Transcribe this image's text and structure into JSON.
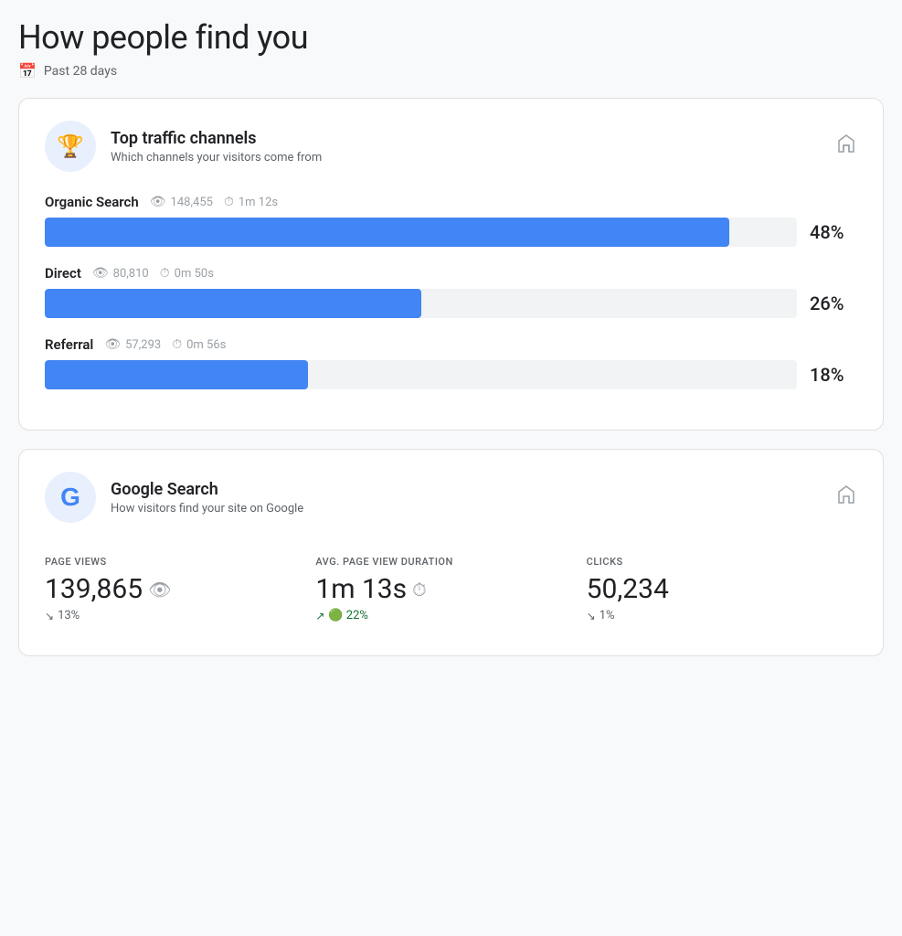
{
  "page": {
    "title": "How people find you",
    "date_range": "Past 28 days"
  },
  "traffic_card": {
    "title": "Top traffic channels",
    "subtitle": "Which channels your visitors come from",
    "channels": [
      {
        "name": "Organic Search",
        "views": "148,455",
        "duration": "1m 12s",
        "percent": 48,
        "percent_label": "48%",
        "bar_width": "91"
      },
      {
        "name": "Direct",
        "views": "80,810",
        "duration": "0m 50s",
        "percent": 26,
        "percent_label": "26%",
        "bar_width": "50"
      },
      {
        "name": "Referral",
        "views": "57,293",
        "duration": "0m 56s",
        "percent": 18,
        "percent_label": "18%",
        "bar_width": "35"
      }
    ]
  },
  "google_search_card": {
    "title": "Google Search",
    "subtitle": "How visitors find your site on Google",
    "stats": [
      {
        "label": "PAGE VIEWS",
        "value": "139,865",
        "has_eye_icon": true,
        "change": "13%",
        "change_direction": "down"
      },
      {
        "label": "AVG. PAGE VIEW DURATION",
        "value": "1m 13s",
        "has_clock_icon": true,
        "change": "22%",
        "change_direction": "up"
      },
      {
        "label": "CLICKS",
        "value": "50,234",
        "has_eye_icon": false,
        "change": "1%",
        "change_direction": "down"
      }
    ]
  }
}
